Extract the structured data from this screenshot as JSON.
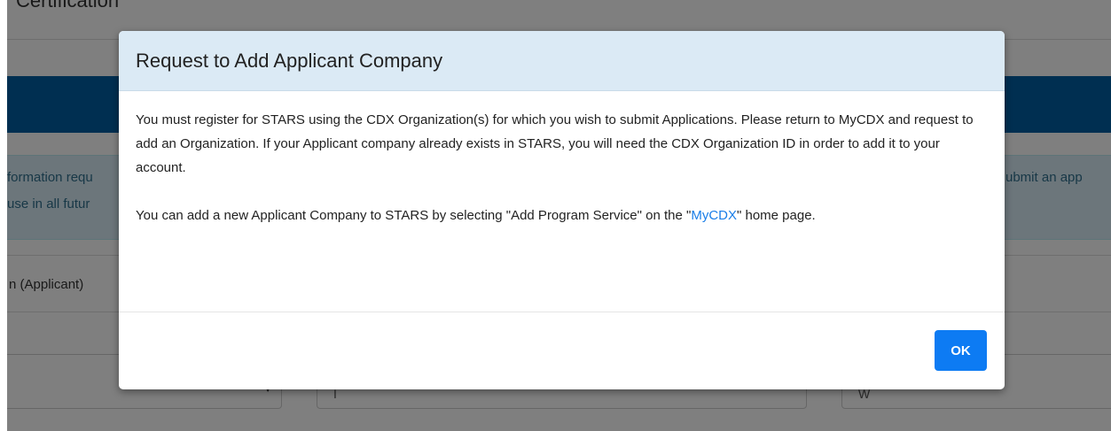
{
  "background": {
    "page_title_fragment": "Certification",
    "alert_left_lines": [
      "formation requ",
      "use in all futur"
    ],
    "alert_right_line": "ubmit an app",
    "section_label": "n (Applicant)",
    "field_values": [
      "",
      "I",
      "W"
    ]
  },
  "modal": {
    "title": "Request to Add Applicant Company",
    "paragraph1": "You must register for STARS using the CDX Organization(s) for which you wish to submit Applications. Please return to MyCDX and request to add an Organization. If your Applicant company already exists in STARS, you will need the CDX Organization ID in order to add it to your account.",
    "paragraph2_prefix": "You can add a new Applicant Company to STARS by selecting \"Add Program Service\" on the \"",
    "paragraph2_link": "MyCDX",
    "paragraph2_suffix": "\" home page.",
    "ok_label": "OK"
  },
  "colors": {
    "header_bg": "#dbeaf5",
    "primary_button": "#0d7bf3",
    "link": "#1a7ee8",
    "brand_bar": "#005ea2"
  }
}
